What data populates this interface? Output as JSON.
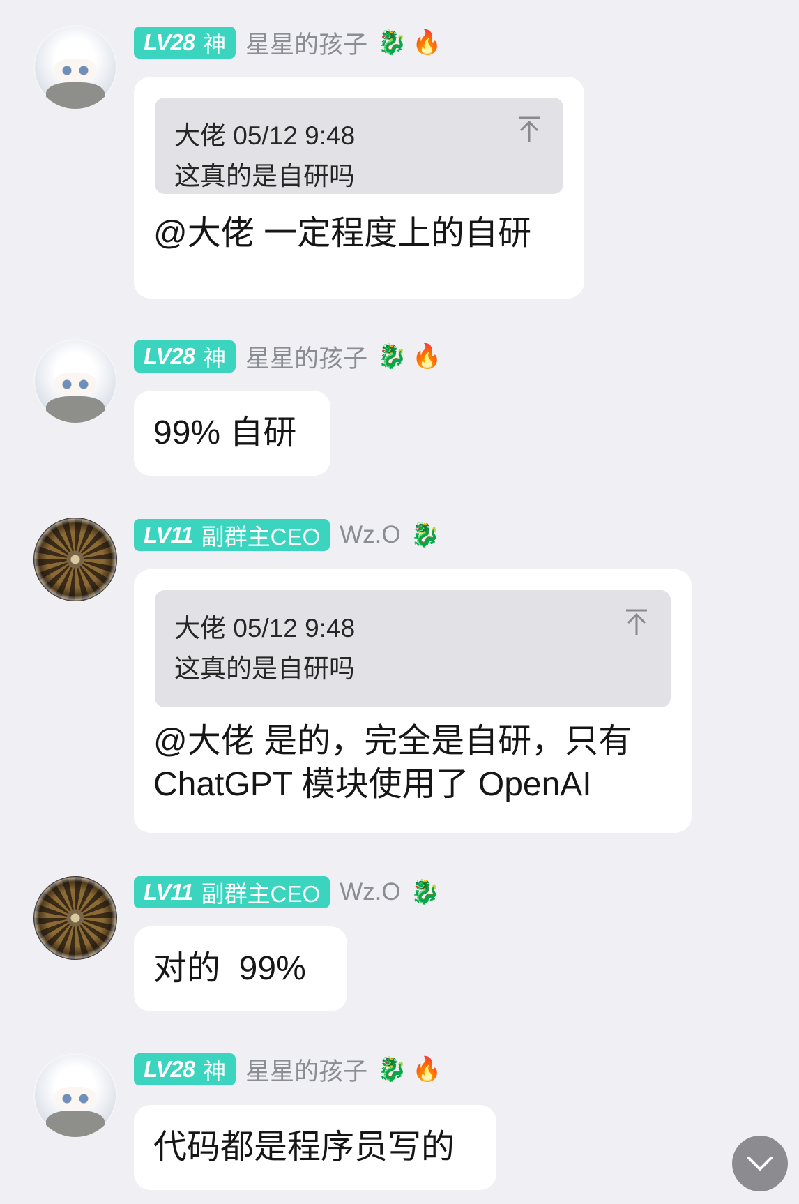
{
  "messages": [
    {
      "user": {
        "level": "LV28",
        "title": "神",
        "nickname": "星星的孩子",
        "decorations": [
          "dragon-icon",
          "fire-icon"
        ]
      },
      "quote": {
        "author_time": "大佬 05/12 9:48",
        "text": "这真的是自研吗"
      },
      "text": "@大佬 一定程度上的自研"
    },
    {
      "user": {
        "level": "LV28",
        "title": "神",
        "nickname": "星星的孩子",
        "decorations": [
          "dragon-icon",
          "fire-icon"
        ]
      },
      "text": "99% 自研"
    },
    {
      "user": {
        "level": "LV11",
        "title": "副群主CEO",
        "nickname": "Wz.O",
        "decorations": [
          "dragon-icon"
        ]
      },
      "quote": {
        "author_time": "大佬 05/12 9:48",
        "text": "这真的是自研吗"
      },
      "text_lines": [
        "@大佬 是的，完全是自研，只有",
        "ChatGPT 模块使用了 OpenAI"
      ]
    },
    {
      "user": {
        "level": "LV11",
        "title": "副群主CEO",
        "nickname": "Wz.O",
        "decorations": [
          "dragon-icon"
        ]
      },
      "text": "对的  99%"
    },
    {
      "user": {
        "level": "LV28",
        "title": "神",
        "nickname": "星星的孩子",
        "decorations": [
          "dragon-icon",
          "fire-icon"
        ]
      },
      "text": "代码都是程序员写的"
    }
  ],
  "colors": {
    "badge": "#3ad4bf",
    "background": "#efeff4",
    "bubble": "#ffffff",
    "quote": "#e2e2e6"
  },
  "scroll_button": {
    "icon": "chevron-down-icon"
  }
}
